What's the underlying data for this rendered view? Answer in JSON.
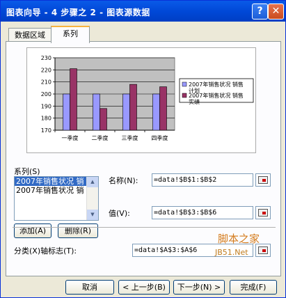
{
  "window": {
    "title": "图表向导 - 4 步骤之 2 - 图表源数据",
    "help_glyph": "?",
    "close_glyph": "✕"
  },
  "tabs": [
    {
      "label": "数据区域"
    },
    {
      "label": "系列"
    }
  ],
  "series_section": {
    "label": "系列(S)",
    "items": [
      "2007年销售状况 销",
      "2007年销售状况 销"
    ],
    "selected_index": 0,
    "add_label": "添加(A)",
    "delete_label": "删除(R)"
  },
  "name_field": {
    "label": "名称(N):",
    "value": "=data!$B$1:$B$2"
  },
  "value_field": {
    "label": "值(V):",
    "value": "=data!$B$3:$B$6"
  },
  "category_field": {
    "label": "分类(X)轴标志(T):",
    "value": "=data!$A$3:$A$6"
  },
  "buttons": {
    "cancel": "取消",
    "back": "< 上一步(B)",
    "next": "下一步(N) >",
    "finish": "完成(F)"
  },
  "watermark": {
    "line1": "脚本之家",
    "line2": "JB51.Net"
  },
  "chart_data": {
    "type": "bar",
    "categories": [
      "一季度",
      "二季度",
      "三季度",
      "四季度"
    ],
    "series": [
      {
        "name": "2007年销售状况 销售计划",
        "values": [
          200,
          200,
          200,
          200
        ]
      },
      {
        "name": "2007年销售状况 销售实绩",
        "values": [
          221,
          188,
          208,
          206
        ]
      }
    ],
    "ylim": [
      170,
      230
    ],
    "yticks": [
      170,
      180,
      190,
      200,
      210,
      220,
      230
    ],
    "legend_position": "right",
    "legend_lines": [
      [
        "2007年销售状况 销售",
        "计划"
      ],
      [
        "2007年销售状况 销售",
        "实绩"
      ]
    ],
    "colors": {
      "series0": "#9999ff",
      "series1": "#993366",
      "plot_bg": "#c0c0c0"
    }
  }
}
